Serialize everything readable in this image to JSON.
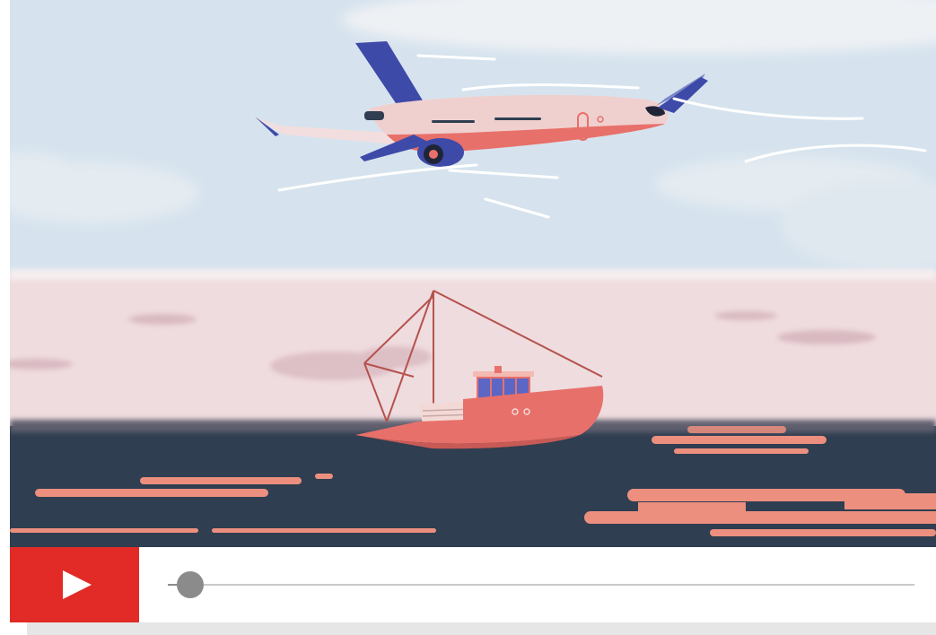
{
  "player": {
    "scene": {
      "icons": [
        "airplane-icon",
        "fishing-boat-icon"
      ],
      "colors": {
        "sky": "#d6e3ee",
        "horizon": "#efdcdf",
        "sea": "#2f3e50",
        "reflection": "#ec8f7f",
        "plane_body": "#f0d0cf",
        "plane_accent": "#3e4aa8",
        "boat_hull": "#e8706a"
      }
    },
    "controls": {
      "play_icon": "play-icon",
      "play_color": "#e22b27",
      "progress": 0.03
    }
  }
}
